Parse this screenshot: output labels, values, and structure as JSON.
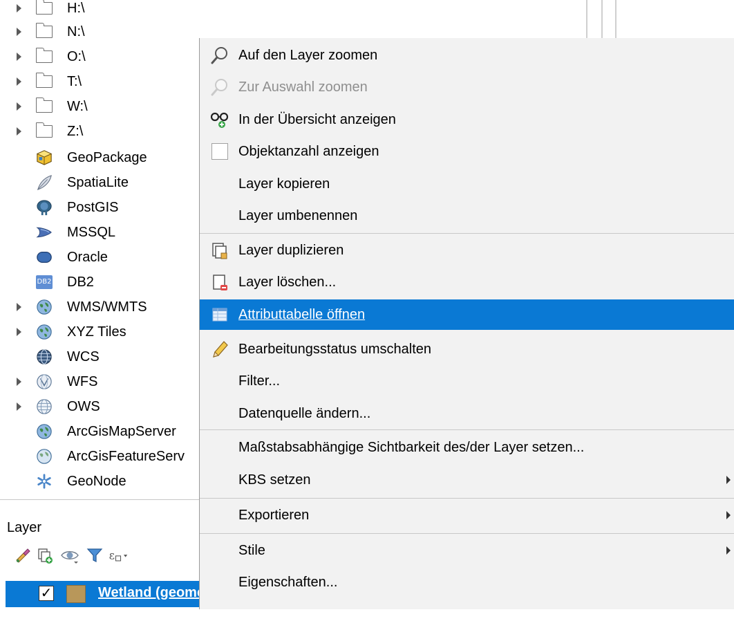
{
  "browser": {
    "items": [
      {
        "label": "H:\\",
        "type": "drive",
        "expandable": true
      },
      {
        "label": "N:\\",
        "type": "drive",
        "expandable": true
      },
      {
        "label": "O:\\",
        "type": "drive",
        "expandable": true
      },
      {
        "label": "T:\\",
        "type": "drive",
        "expandable": true
      },
      {
        "label": "W:\\",
        "type": "drive",
        "expandable": true
      },
      {
        "label": "Z:\\",
        "type": "drive",
        "expandable": true
      },
      {
        "label": "GeoPackage",
        "icon": "geopackage-icon"
      },
      {
        "label": "SpatiaLite",
        "icon": "spatialite-feather-icon"
      },
      {
        "label": "PostGIS",
        "icon": "postgis-elephant-icon"
      },
      {
        "label": "MSSQL",
        "icon": "mssql-icon"
      },
      {
        "label": "Oracle",
        "icon": "oracle-icon"
      },
      {
        "label": "DB2",
        "icon": "db2-icon",
        "icon_text": "DB2"
      },
      {
        "label": "WMS/WMTS",
        "icon": "wms-globe-icon",
        "expandable": true
      },
      {
        "label": "XYZ Tiles",
        "icon": "xyz-globe-icon",
        "expandable": true
      },
      {
        "label": "WCS",
        "icon": "wcs-globe-icon"
      },
      {
        "label": "WFS",
        "icon": "wfs-globe-icon",
        "expandable": true
      },
      {
        "label": "OWS",
        "icon": "ows-globe-icon",
        "expandable": true
      },
      {
        "label": "ArcGisMapServer",
        "icon": "arcgis-map-globe-icon"
      },
      {
        "label": "ArcGisFeatureServ",
        "icon": "arcgis-feature-globe-icon"
      },
      {
        "label": "GeoNode",
        "icon": "geonode-icon"
      }
    ]
  },
  "layer_panel": {
    "title": "Layer",
    "toolbar": [
      "style-brush-icon",
      "add-group-icon",
      "visibility-eye-icon",
      "filter-funnel-icon",
      "expression-filter-icon"
    ],
    "layer": {
      "name": "Wetland (geometry)",
      "checked": "✓",
      "color": "#b8975a"
    }
  },
  "context_menu": {
    "items": [
      {
        "label": "Auf den Layer zoomen",
        "icon": "zoom-to-layer-icon"
      },
      {
        "label": "Zur Auswahl zoomen",
        "icon": "zoom-to-selection-icon",
        "disabled": true
      },
      {
        "label": "In der Übersicht anzeigen",
        "icon": "overview-glasses-icon"
      },
      {
        "label": "Objektanzahl anzeigen",
        "icon": "checkbox-icon"
      },
      {
        "label": "Layer kopieren"
      },
      {
        "label": "Layer umbenennen"
      },
      {
        "label": "Layer duplizieren",
        "icon": "duplicate-layer-icon"
      },
      {
        "label": "Layer löschen...",
        "icon": "remove-layer-icon"
      },
      {
        "label": "Attributtabelle öffnen",
        "icon": "attribute-table-icon",
        "selected": true
      },
      {
        "label": "Bearbeitungsstatus umschalten",
        "icon": "edit-pencil-icon"
      },
      {
        "label": "Filter..."
      },
      {
        "label": "Datenquelle ändern..."
      },
      {
        "label": "Maßstabsabhängige Sichtbarkeit des/der Layer setzen..."
      },
      {
        "label": "KBS setzen",
        "submenu": true
      },
      {
        "label": "Exportieren",
        "submenu": true
      },
      {
        "label": "Stile",
        "submenu": true
      },
      {
        "label": "Eigenschaften..."
      }
    ]
  },
  "colors": {
    "selection": "#0a79d4",
    "menu_bg": "#f2f2f2"
  }
}
